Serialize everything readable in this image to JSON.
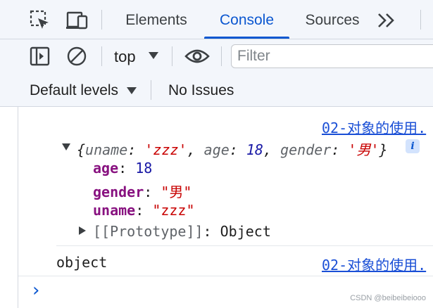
{
  "tabs": {
    "items": [
      "Elements",
      "Console",
      "Sources"
    ],
    "active": "Console",
    "more_icon": "double-chevron-right-icon"
  },
  "toolbar": {
    "context": "top",
    "filter_placeholder": "Filter"
  },
  "levels": {
    "default_levels": "Default levels",
    "issues": "No Issues"
  },
  "console": {
    "source_link": "02-对象的使用.",
    "object_preview": {
      "open": "{",
      "uname_key": "uname",
      "uname_val": "'zzz'",
      "age_key": "age",
      "age_val": "18",
      "gender_key": "gender",
      "gender_val": "'男'",
      "close": "}"
    },
    "props": [
      {
        "key": "age",
        "value": "18"
      },
      {
        "key": "gender",
        "value": "\"男\""
      },
      {
        "key": "uname",
        "value": "\"zzz\""
      }
    ],
    "prototype_label": "[[Prototype]]",
    "prototype_value": "Object",
    "second_message": "object",
    "prompt": "›"
  },
  "watermark": "CSDN @beibeibeiooo",
  "colors": {
    "accent": "#0b57d0",
    "property_key": "#881280",
    "number": "#1a1aa6",
    "string": "#c80000",
    "link": "#1a4fd6"
  }
}
